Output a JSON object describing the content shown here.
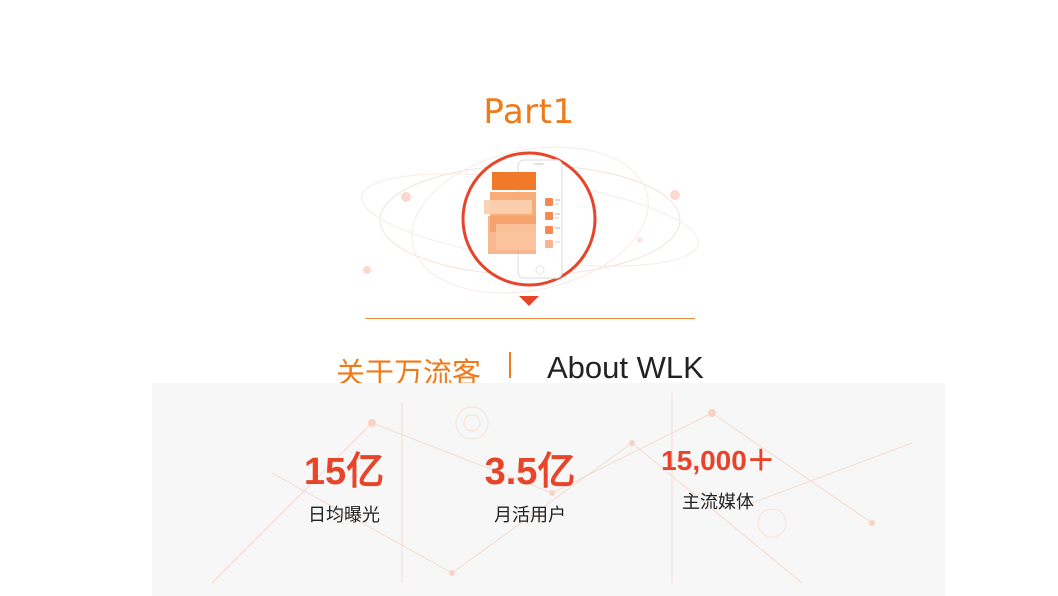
{
  "part": {
    "title": "Part1",
    "emblem_icon": "phone-app-icon"
  },
  "heading": {
    "chinese": "关于万流客",
    "english": "About WLK"
  },
  "stats": [
    {
      "value": "15亿",
      "label": "日均曝光"
    },
    {
      "value": "3.5亿",
      "label": "月活用户"
    },
    {
      "value": "15,000＋",
      "label": "主流媒体"
    }
  ],
  "colors": {
    "accent": "#f07a1a",
    "stat": "#e8442a",
    "text": "#222222",
    "panel": "#f7f7f7"
  }
}
